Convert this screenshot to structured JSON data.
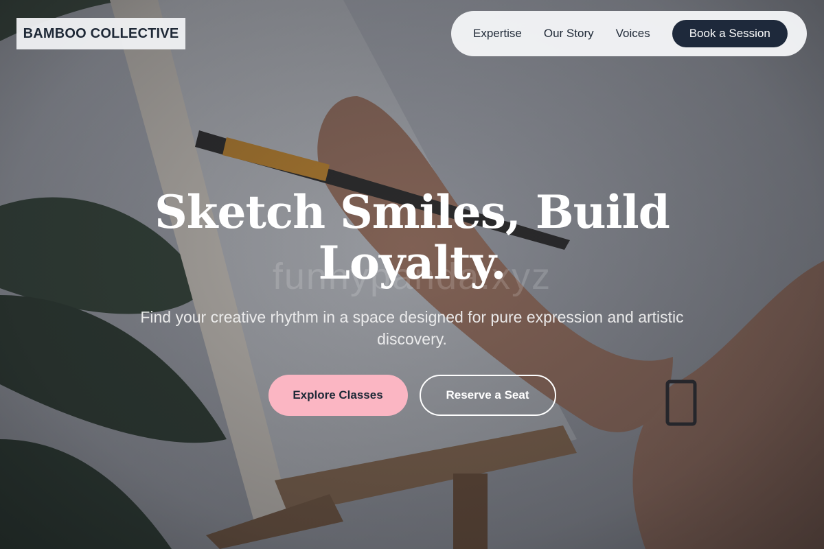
{
  "brand": {
    "logo_text": "BAMBOO COLLECTIVE"
  },
  "nav": {
    "links": [
      {
        "label": "Expertise"
      },
      {
        "label": "Our Story"
      },
      {
        "label": "Voices"
      }
    ],
    "cta_label": "Book a Session"
  },
  "hero": {
    "headline": "Sketch Smiles, Build Loyalty.",
    "watermark": "funnypanda.xyz",
    "subtext": "Find your creative rhythm in a space designed for pure expression and artistic discovery.",
    "primary_button": "Explore Classes",
    "secondary_button": "Reserve a Seat",
    "background_image": "person-painting-on-canvas-easel"
  },
  "colors": {
    "nav_cta_bg": "#1e293b",
    "primary_button_bg": "#fbb6c3",
    "text_dark": "#1f2937",
    "text_light": "#ffffff"
  }
}
